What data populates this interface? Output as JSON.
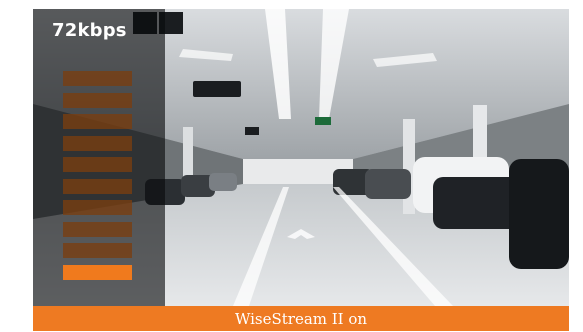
{
  "stream": {
    "bitrate_label": "72kbps",
    "level_total": 10,
    "level_active": 1,
    "accent_color": "#ee7a22"
  },
  "footer": {
    "status_text": "WiseStream II on"
  },
  "camera_feed": {
    "scene": "underground parking garage"
  }
}
